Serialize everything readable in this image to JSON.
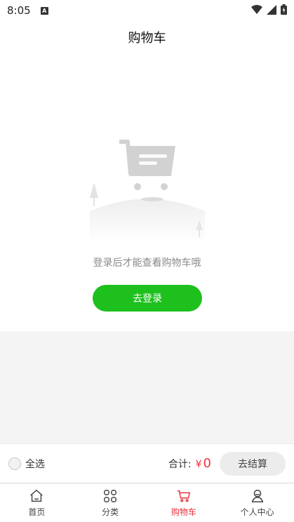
{
  "status_bar": {
    "time": "8:05",
    "a_badge": "A",
    "icons": [
      "wifi-icon",
      "signal-icon",
      "battery-icon"
    ]
  },
  "header": {
    "title": "购物车"
  },
  "empty_state": {
    "message": "登录后才能查看购物车哦",
    "login_button": "去登录",
    "illustration": "empty-cart-icon"
  },
  "checkout": {
    "select_all": "全选",
    "total_label": "合计:",
    "currency": "¥",
    "total_amount": "0",
    "checkout_button": "去结算"
  },
  "nav": {
    "items": [
      {
        "label": "首页",
        "icon": "home-icon",
        "active": false
      },
      {
        "label": "分类",
        "icon": "grid-icon",
        "active": false
      },
      {
        "label": "购物车",
        "icon": "cart-icon",
        "active": true
      },
      {
        "label": "个人中心",
        "icon": "user-icon",
        "active": false
      }
    ]
  },
  "colors": {
    "accent_green": "#1ec01e",
    "active_red": "#e8313b",
    "price_red": "#f0323c"
  }
}
